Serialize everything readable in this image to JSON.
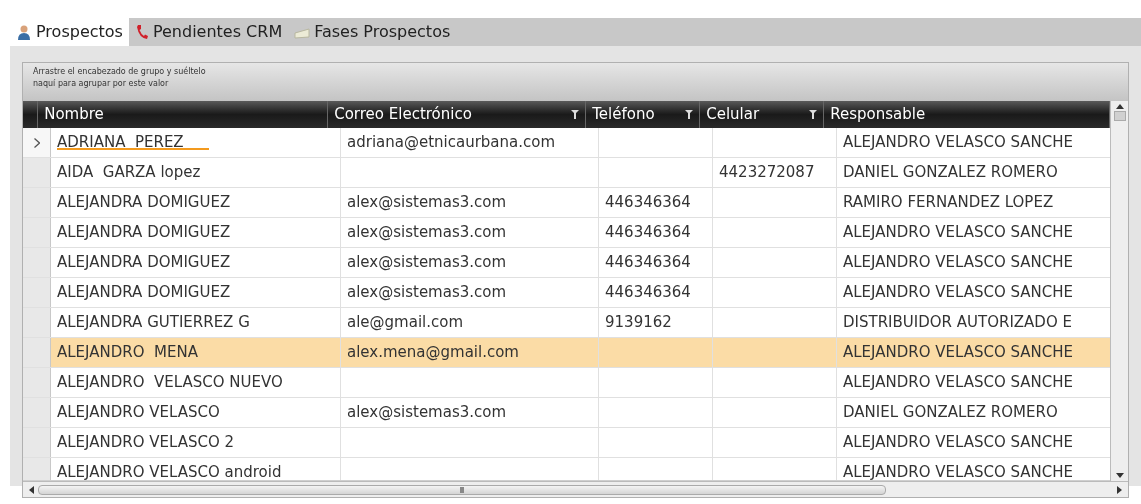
{
  "tabs": [
    {
      "label": "Prospectos",
      "selected": true
    },
    {
      "label": "Pendientes CRM",
      "selected": false
    },
    {
      "label": "Fases Prospectos",
      "selected": false
    }
  ],
  "group_panel": {
    "hint_line_1": "Arrastre el encabezado de grupo y suéltelo",
    "hint_line_2": "naquí para agrupar por este valor"
  },
  "table": {
    "columns": [
      {
        "label": "Nombre",
        "filter": false
      },
      {
        "label": "Correo Electrónico",
        "filter": true
      },
      {
        "label": "Teléfono",
        "filter": true
      },
      {
        "label": "Celular",
        "filter": true
      },
      {
        "label": "Responsable",
        "filter": false
      }
    ],
    "rows": [
      {
        "current": true,
        "selected": false,
        "marked": true,
        "cells": [
          "ADRIANA  PEREZ",
          "adriana@etnicaurbana.com",
          "",
          "",
          "ALEJANDRO VELASCO SANCHE"
        ]
      },
      {
        "current": false,
        "selected": false,
        "marked": false,
        "cells": [
          "AIDA  GARZA lopez",
          "",
          "",
          "4423272087",
          "DANIEL GONZALEZ ROMERO"
        ]
      },
      {
        "current": false,
        "selected": false,
        "marked": false,
        "cells": [
          "ALEJANDRA DOMIGUEZ",
          "alex@sistemas3.com",
          "446346364",
          "",
          "RAMIRO FERNANDEZ LOPEZ"
        ]
      },
      {
        "current": false,
        "selected": false,
        "marked": false,
        "cells": [
          "ALEJANDRA DOMIGUEZ",
          "alex@sistemas3.com",
          "446346364",
          "",
          "ALEJANDRO VELASCO SANCHE"
        ]
      },
      {
        "current": false,
        "selected": false,
        "marked": false,
        "cells": [
          "ALEJANDRA DOMIGUEZ",
          "alex@sistemas3.com",
          "446346364",
          "",
          "ALEJANDRO VELASCO SANCHE"
        ]
      },
      {
        "current": false,
        "selected": false,
        "marked": false,
        "cells": [
          "ALEJANDRA DOMIGUEZ",
          "alex@sistemas3.com",
          "446346364",
          "",
          "ALEJANDRO VELASCO SANCHE"
        ]
      },
      {
        "current": false,
        "selected": false,
        "marked": false,
        "cells": [
          "ALEJANDRA GUTIERREZ G",
          "ale@gmail.com",
          "9139162",
          "",
          "DISTRIBUIDOR AUTORIZADO E"
        ]
      },
      {
        "current": false,
        "selected": true,
        "marked": false,
        "cells": [
          "ALEJANDRO  MENA",
          "alex.mena@gmail.com",
          "",
          "",
          "ALEJANDRO VELASCO SANCHE"
        ]
      },
      {
        "current": false,
        "selected": false,
        "marked": false,
        "cells": [
          "ALEJANDRO  VELASCO NUEVO",
          "",
          "",
          "",
          "ALEJANDRO VELASCO SANCHE"
        ]
      },
      {
        "current": false,
        "selected": false,
        "marked": false,
        "cells": [
          "ALEJANDRO VELASCO",
          "alex@sistemas3.com",
          "",
          "",
          "DANIEL GONZALEZ ROMERO"
        ]
      },
      {
        "current": false,
        "selected": false,
        "marked": false,
        "cells": [
          "ALEJANDRO VELASCO 2",
          "",
          "",
          "",
          "ALEJANDRO VELASCO SANCHE"
        ]
      },
      {
        "current": false,
        "selected": false,
        "marked": false,
        "cells": [
          "ALEJANDRO VELASCO android",
          "",
          "",
          "",
          "ALEJANDRO VELASCO SANCHE"
        ]
      }
    ]
  }
}
